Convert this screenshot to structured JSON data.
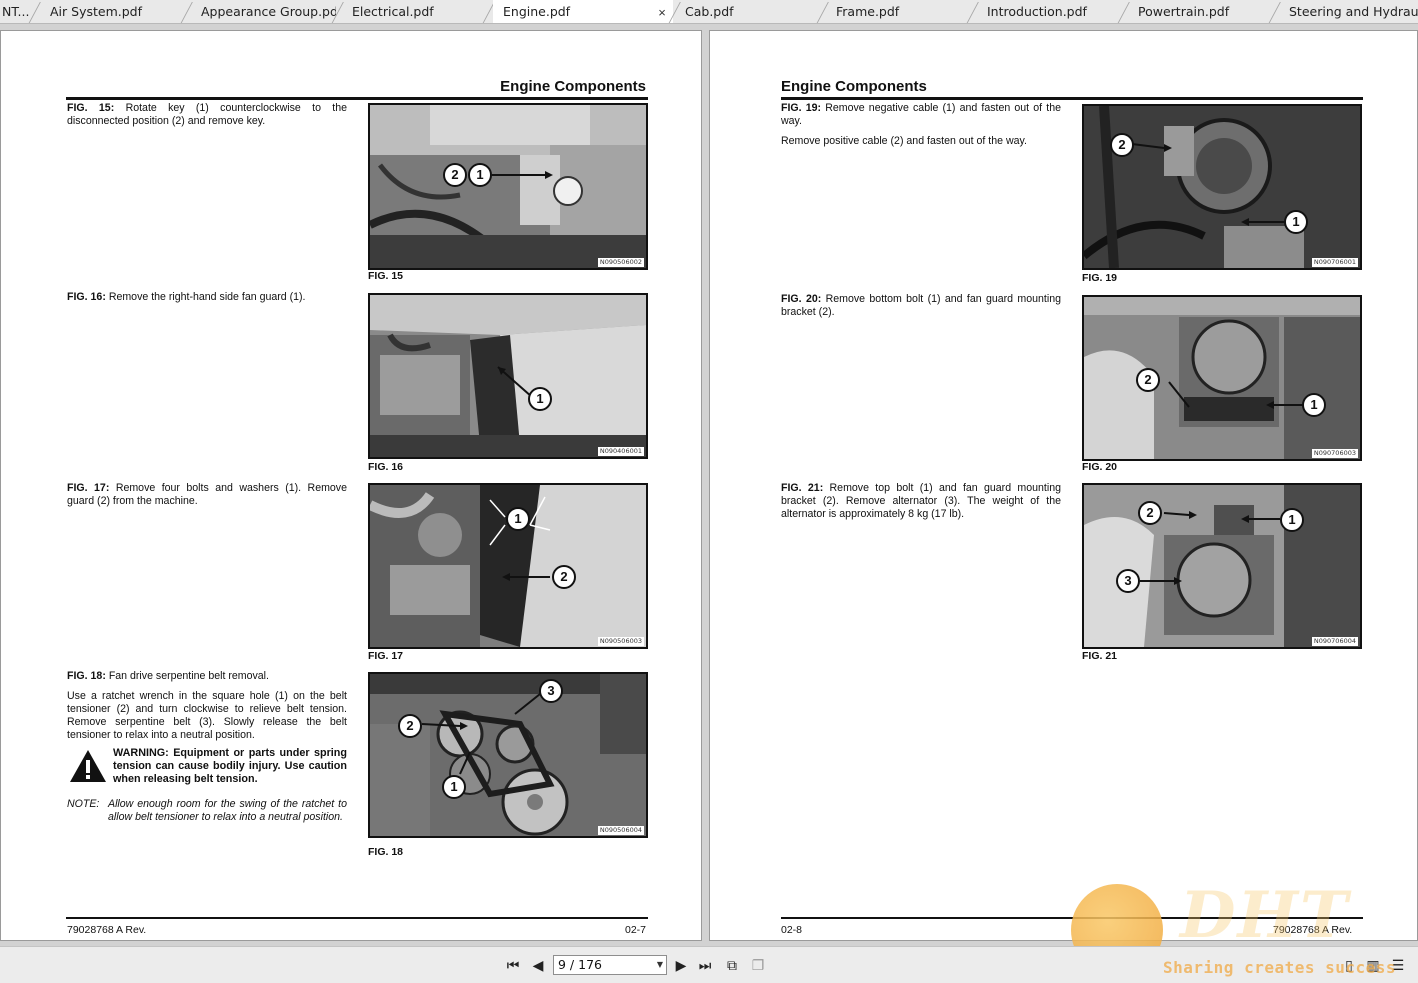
{
  "tabs": [
    {
      "label": "NT...."
    },
    {
      "label": "Air System.pdf"
    },
    {
      "label": "Appearance Group.pdf"
    },
    {
      "label": "Electrical.pdf"
    },
    {
      "label": "Engine.pdf",
      "active": true
    },
    {
      "label": "Cab.pdf"
    },
    {
      "label": "Frame.pdf"
    },
    {
      "label": "Introduction.pdf"
    },
    {
      "label": "Powertrain.pdf"
    },
    {
      "label": "Steering and Hydrauli..."
    }
  ],
  "tab_close_glyph": "×",
  "left_page": {
    "title": "Engine Components",
    "fig15": {
      "label": "FIG. 15:",
      "text": "Rotate key (1) counterclockwise to the disconnected position (2) and remove key.",
      "caption": "FIG. 15",
      "code": "N090506002",
      "callouts": [
        "2",
        "1"
      ]
    },
    "fig16": {
      "label": "FIG. 16:",
      "text": "Remove the right-hand side fan guard (1).",
      "caption": "FIG. 16",
      "code": "N090406001",
      "callouts": [
        "1"
      ]
    },
    "fig17": {
      "label": "FIG. 17:",
      "text": "Remove four bolts and washers (1). Remove guard (2) from the machine.",
      "caption": "FIG. 17",
      "code": "N090506003",
      "callouts": [
        "1",
        "2"
      ]
    },
    "fig18": {
      "label": "FIG. 18:",
      "text": "Fan drive serpentine belt removal.",
      "text2": "Use a ratchet wrench in the square hole (1) on the belt tensioner (2) and turn clockwise to relieve belt tension. Remove serpentine belt (3). Slowly release the belt tensioner to relax into a neutral position.",
      "warning": "WARNING: Equipment or parts under spring tension can cause bodily injury. Use caution when releasing belt tension.",
      "note_label": "NOTE:",
      "note": "Allow enough room for the swing of the ratchet to allow belt tensioner to relax into a neutral position.",
      "caption": "FIG. 18",
      "code": "N090506004",
      "callouts": [
        "3",
        "2",
        "1"
      ]
    },
    "footer_left": "79028768 A Rev.",
    "footer_right": "02-7"
  },
  "right_page": {
    "title": "Engine Components",
    "fig19": {
      "label": "FIG. 19:",
      "text": "Remove negative cable (1) and fasten out of the way.",
      "text2": "Remove positive cable (2) and fasten out of the way.",
      "caption": "FIG. 19",
      "code": "N090706001",
      "callouts": [
        "2",
        "1"
      ]
    },
    "fig20": {
      "label": "FIG. 20:",
      "text": "Remove bottom bolt (1) and fan guard mounting bracket (2).",
      "caption": "FIG. 20",
      "code": "N090706003",
      "callouts": [
        "2",
        "1"
      ]
    },
    "fig21": {
      "label": "FIG. 21:",
      "text": "Remove top bolt (1) and fan guard mounting bracket (2). Remove alternator (3). The weight of the alternator is approximately 8 kg (17 lb).",
      "caption": "FIG. 21",
      "code": "N090706004",
      "callouts": [
        "2",
        "1",
        "3"
      ]
    },
    "footer_left": "02-8",
    "footer_right": "79028768 A Rev."
  },
  "toolbar": {
    "page_display": "9 / 176",
    "icons": [
      "first-page-icon",
      "prev-page-icon",
      "next-page-icon",
      "last-page-icon",
      "export-icon",
      "copy-icon",
      "single-page-icon",
      "two-page-icon",
      "continuous-icon"
    ]
  },
  "watermark": {
    "brand": "DHT",
    "slogan": "Sharing creates success"
  }
}
